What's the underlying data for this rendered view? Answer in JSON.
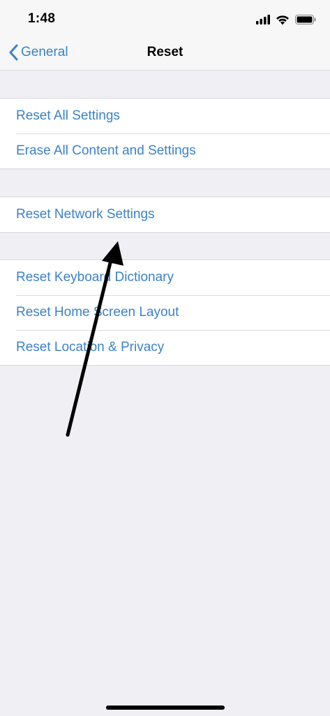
{
  "status_bar": {
    "time": "1:48",
    "icons": [
      "cellular-signal-icon",
      "wifi-icon",
      "battery-icon"
    ]
  },
  "nav_bar": {
    "back_label": "General",
    "title": "Reset"
  },
  "groups": [
    {
      "rows": [
        {
          "label": "Reset All Settings"
        },
        {
          "label": "Erase All Content and Settings"
        }
      ]
    },
    {
      "rows": [
        {
          "label": "Reset Network Settings"
        }
      ]
    },
    {
      "rows": [
        {
          "label": "Reset Keyboard Dictionary"
        },
        {
          "label": "Reset Home Screen Layout"
        },
        {
          "label": "Reset Location & Privacy"
        }
      ]
    }
  ],
  "colors": {
    "accent": "#3b82c8",
    "background": "#efeff4",
    "annotation": "#000000"
  }
}
